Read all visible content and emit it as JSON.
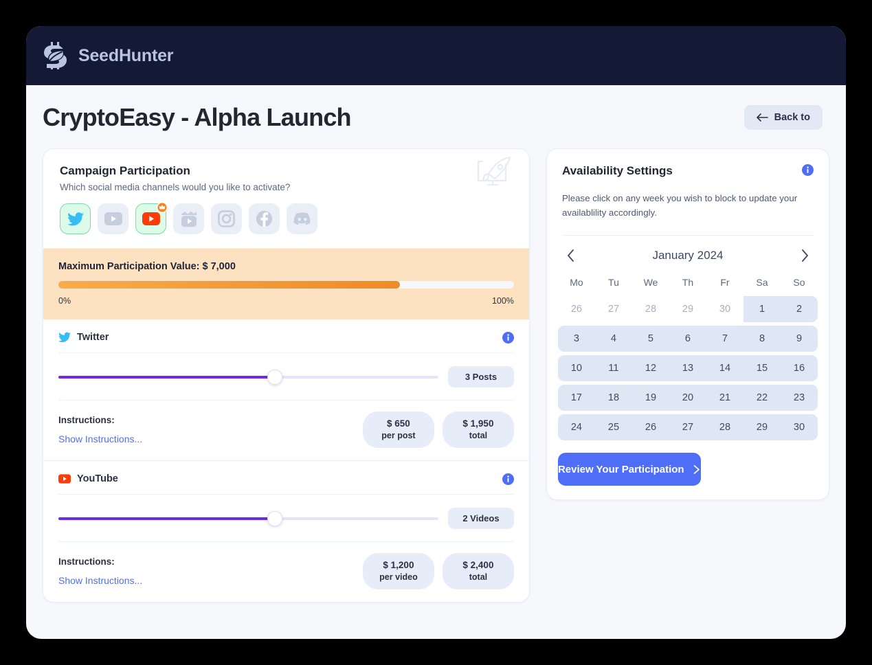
{
  "brand": {
    "name": "SeedHunter",
    "logo_icon": "seedhunter-logo-icon"
  },
  "header": {
    "page_title": "CryptoEasy - Alpha Launch",
    "back_button": {
      "label": "Back to",
      "icon": "arrow-left-icon"
    }
  },
  "campaign": {
    "title": "Campaign Participation",
    "subtitle": "Which social media channels would you like to activate?",
    "decor_icon": "rocket-launch-icon",
    "channels": [
      {
        "name": "twitter",
        "icon": "twitter-icon",
        "selected": true,
        "badge": null
      },
      {
        "name": "youtube",
        "icon": "youtube-icon",
        "selected": false,
        "badge": null
      },
      {
        "name": "youtube-premium",
        "icon": "youtube-icon",
        "selected": true,
        "badge": "crown-icon"
      },
      {
        "name": "tiktok",
        "icon": "tiktok-clapper-icon",
        "selected": false,
        "badge": null
      },
      {
        "name": "instagram",
        "icon": "instagram-icon",
        "selected": false,
        "badge": null
      },
      {
        "name": "facebook",
        "icon": "facebook-icon",
        "selected": false,
        "badge": null
      },
      {
        "name": "discord",
        "icon": "discord-icon",
        "selected": false,
        "badge": null
      }
    ],
    "max_value": {
      "label": "Maximum Participation Value: $ 7,000",
      "percent": 75,
      "scale_min": "0%",
      "scale_max": "100%",
      "fill_color": "#ef8a28",
      "background_color": "#fce2c0"
    },
    "blocks": [
      {
        "name": "Twitter",
        "icon": "twitter-icon",
        "info_icon": "info-icon",
        "slider": {
          "percent": 57,
          "count_label": "3 Posts"
        },
        "instructions_label": "Instructions:",
        "instructions_link": "Show Instructions...",
        "pills": [
          {
            "amount": "$ 650",
            "unit": "per post"
          },
          {
            "amount": "$ 1,950",
            "unit": "total"
          }
        ]
      },
      {
        "name": "YouTube",
        "icon": "youtube-icon",
        "info_icon": "info-icon",
        "slider": {
          "percent": 57,
          "count_label": "2 Videos"
        },
        "instructions_label": "Instructions:",
        "instructions_link": "Show Instructions...",
        "pills": [
          {
            "amount": "$ 1,200",
            "unit": "per video"
          },
          {
            "amount": "$ 2,400",
            "unit": "total"
          }
        ]
      }
    ]
  },
  "availability": {
    "title": "Availability Settings",
    "info_icon": "info-icon",
    "note": "Please click on any week you wish to block to update your availablility accordingly.",
    "calendar": {
      "month_label": "January 2024",
      "prev_icon": "chevron-left-icon",
      "next_icon": "chevron-right-icon",
      "weekdays": [
        "Mo",
        "Tu",
        "We",
        "Th",
        "Fr",
        "Sa",
        "So"
      ],
      "weeks": [
        {
          "state": "partial",
          "days": [
            {
              "n": "26",
              "muted": true
            },
            {
              "n": "27",
              "muted": true
            },
            {
              "n": "28",
              "muted": true
            },
            {
              "n": "29",
              "muted": true
            },
            {
              "n": "30",
              "muted": true
            },
            {
              "n": "1",
              "muted": false
            },
            {
              "n": "2",
              "muted": false
            }
          ]
        },
        {
          "state": "blocked",
          "days": [
            {
              "n": "3",
              "muted": false
            },
            {
              "n": "4",
              "muted": false
            },
            {
              "n": "5",
              "muted": false
            },
            {
              "n": "6",
              "muted": false
            },
            {
              "n": "7",
              "muted": false
            },
            {
              "n": "8",
              "muted": false
            },
            {
              "n": "9",
              "muted": false
            }
          ]
        },
        {
          "state": "blocked",
          "days": [
            {
              "n": "10",
              "muted": false
            },
            {
              "n": "11",
              "muted": false
            },
            {
              "n": "12",
              "muted": false
            },
            {
              "n": "13",
              "muted": false
            },
            {
              "n": "14",
              "muted": false
            },
            {
              "n": "15",
              "muted": false
            },
            {
              "n": "16",
              "muted": false
            }
          ]
        },
        {
          "state": "blocked",
          "days": [
            {
              "n": "17",
              "muted": false
            },
            {
              "n": "18",
              "muted": false
            },
            {
              "n": "19",
              "muted": false
            },
            {
              "n": "20",
              "muted": false
            },
            {
              "n": "21",
              "muted": false
            },
            {
              "n": "22",
              "muted": false
            },
            {
              "n": "23",
              "muted": false
            }
          ]
        },
        {
          "state": "blocked",
          "days": [
            {
              "n": "24",
              "muted": false
            },
            {
              "n": "25",
              "muted": false
            },
            {
              "n": "26",
              "muted": false
            },
            {
              "n": "27",
              "muted": false
            },
            {
              "n": "28",
              "muted": false
            },
            {
              "n": "29",
              "muted": false
            },
            {
              "n": "30",
              "muted": false
            }
          ]
        }
      ]
    },
    "review_button": {
      "label": "Review Your Participation",
      "icon": "chevron-right-icon"
    }
  },
  "colors": {
    "header_bg": "#141a35",
    "page_bg": "#f6f8fc",
    "accent_blue": "#4f6ef7",
    "slider_purple": "#6d28f5",
    "banner_orange": "#ef8a28",
    "selected_green": "#ddfbe9",
    "calendar_blocked": "#dfe7f5"
  }
}
